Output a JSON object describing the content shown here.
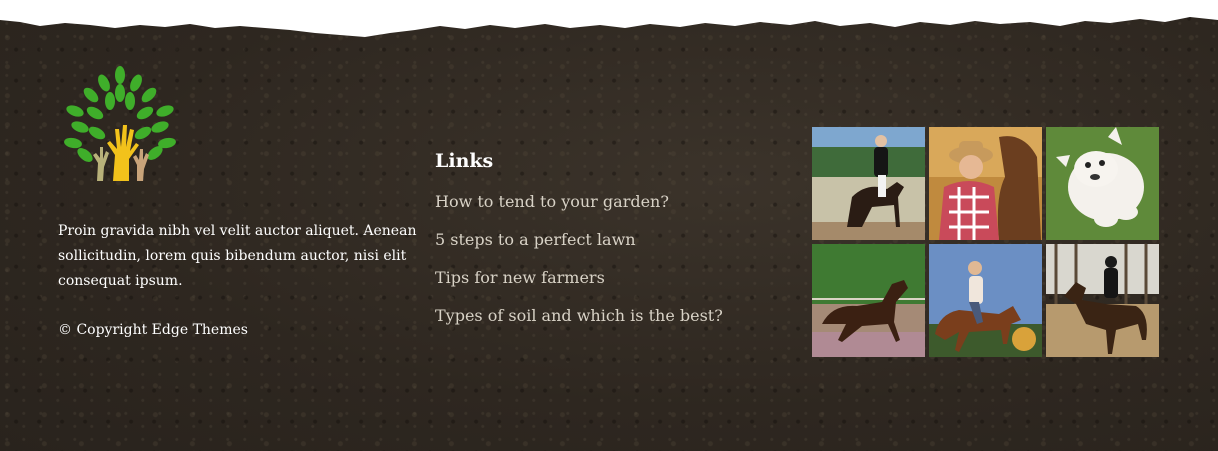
{
  "logo": {
    "icon": "tree-hands-logo"
  },
  "about": {
    "text": "Proin gravida nibh vel velit auctor aliquet. Aenean sollicitudin, lorem quis bibendum auctor, nisi elit consequat ipsum."
  },
  "copyright": "© Copyright Edge Themes",
  "links": {
    "title": "Links",
    "items": [
      "How to tend to your garden?",
      "5 steps to a perfect lawn",
      "Tips for new farmers",
      "Types of soil and which is the best?"
    ]
  },
  "gallery": {
    "images": [
      {
        "subject": "dressage-rider-photo"
      },
      {
        "subject": "farmer-with-horse-photo"
      },
      {
        "subject": "white-dog-on-grass-photo"
      },
      {
        "subject": "horse-running-photo"
      },
      {
        "subject": "woman-riding-horse-photo"
      },
      {
        "subject": "rider-on-horse-photo"
      }
    ]
  },
  "colors": {
    "soil": "#2e2720",
    "text": "#ffffff",
    "link": "#d8d2c6",
    "leaf_green": "#3fae2a",
    "hand_yellow": "#f2c21b"
  }
}
